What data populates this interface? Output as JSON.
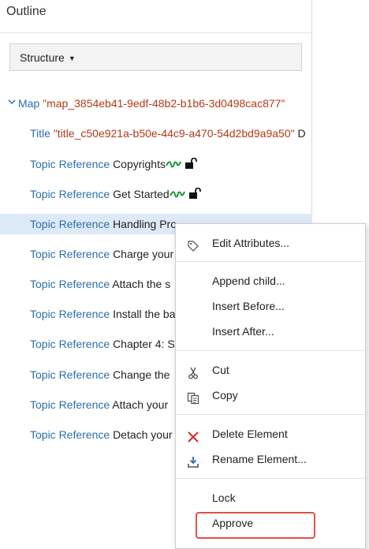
{
  "panel": {
    "title": "Outline",
    "structure_button": {
      "label": "Structure"
    }
  },
  "tree": {
    "map": {
      "kind": "Map",
      "id": "\"map_3854eb41-9edf-48b2-b1b6-3d0498cac877\""
    },
    "title_row": {
      "kind": "Title",
      "id": "\"title_c50e921a-b50e-44c9-a470-54d2bd9a9a50\"",
      "tail": "D"
    },
    "topics": [
      {
        "kind": "Topic Reference",
        "text": "Copyrights"
      },
      {
        "kind": "Topic Reference",
        "text": "Get Started"
      },
      {
        "kind": "Topic Reference",
        "text": "Handling Pro"
      },
      {
        "kind": "Topic Reference",
        "text": "Charge your"
      },
      {
        "kind": "Topic Reference",
        "text": "Attach the s"
      },
      {
        "kind": "Topic Reference",
        "text": "Install the ba"
      },
      {
        "kind": "Topic Reference",
        "text": "Chapter 4: S"
      },
      {
        "kind": "Topic Reference",
        "text": "Change the"
      },
      {
        "kind": "Topic Reference",
        "text": "Attach your"
      },
      {
        "kind": "Topic Reference",
        "text": "Detach your"
      }
    ]
  },
  "context_menu": {
    "edit_attributes": "Edit Attributes...",
    "append_child": "Append child...",
    "insert_before": "Insert Before...",
    "insert_after": "Insert After...",
    "cut": "Cut",
    "copy": "Copy",
    "delete_element": "Delete Element",
    "rename_element": "Rename Element...",
    "lock": "Lock",
    "approve": "Approve"
  },
  "colors": {
    "node_kind": "#2c6fad",
    "attribute_value": "#b33a1a",
    "selected_row": "#dde9f6",
    "highlight_border": "#e2514a",
    "delete_icon": "#d9322a"
  }
}
